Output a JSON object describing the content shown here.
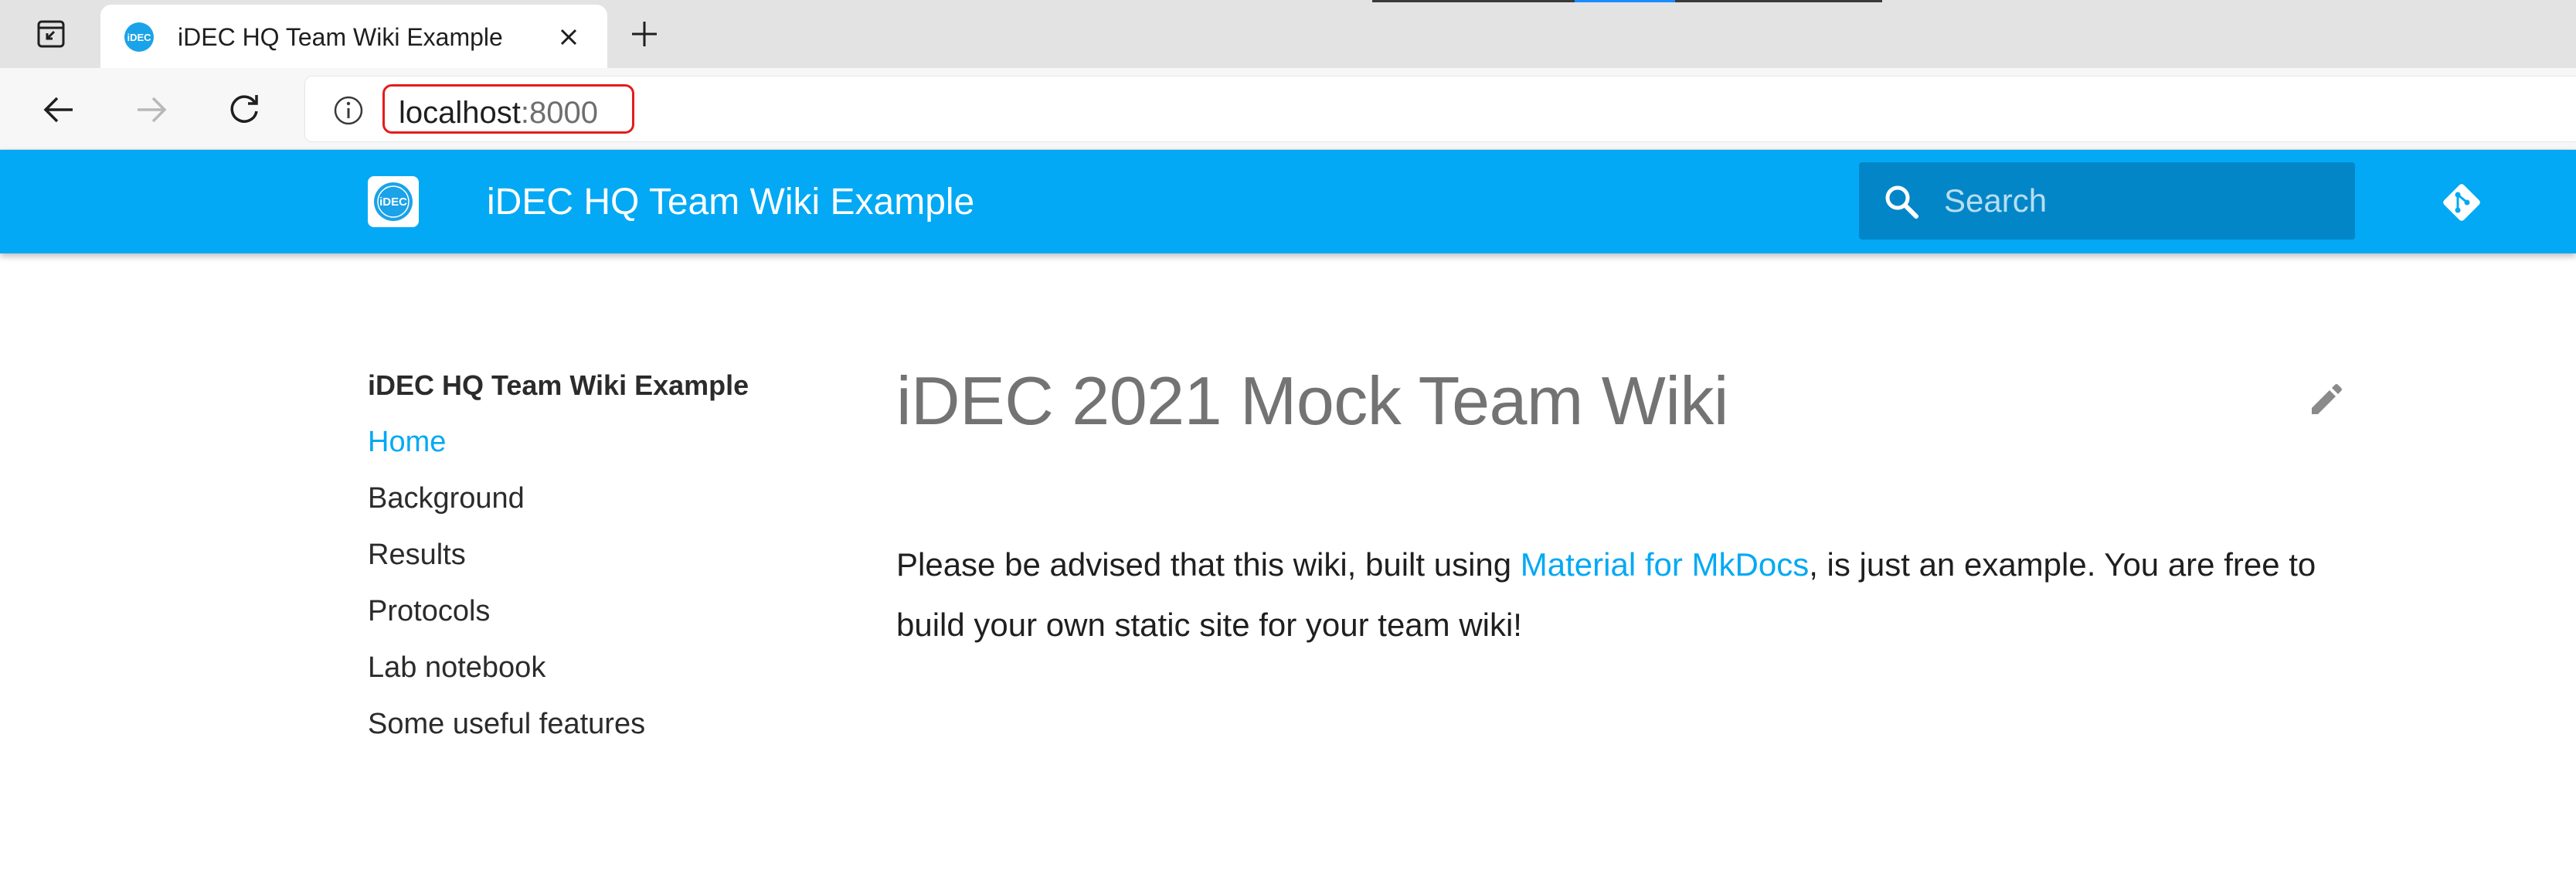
{
  "browser": {
    "tab": {
      "title": "iDEC HQ Team Wiki Example"
    },
    "address": {
      "host": "localhost",
      "port": ":8000"
    }
  },
  "site": {
    "name": "iDEC HQ Team Wiki Example",
    "logo_text": "iDEC",
    "search_placeholder": "Search",
    "header_color": "#03a9f4"
  },
  "nav": {
    "title": "iDEC HQ Team Wiki Example",
    "items": [
      {
        "label": "Home",
        "active": true
      },
      {
        "label": "Background"
      },
      {
        "label": "Results"
      },
      {
        "label": "Protocols"
      },
      {
        "label": "Lab notebook"
      },
      {
        "label": "Some useful features"
      }
    ]
  },
  "content": {
    "title": "iDEC 2021 Mock Team Wiki",
    "intro_before": "Please be advised that this wiki, built using ",
    "intro_link": "Material for MkDocs",
    "intro_after": ", is just an example. You are free to build your own static site for your team wiki!"
  },
  "icons": {
    "tab_actions": "tab-actions-icon",
    "close": "close-icon",
    "new_tab": "plus-icon",
    "back": "back-arrow-icon",
    "forward": "forward-arrow-icon",
    "refresh": "refresh-icon",
    "site_info": "info-icon",
    "search": "search-icon",
    "repo": "git-icon",
    "edit": "pencil-icon"
  }
}
